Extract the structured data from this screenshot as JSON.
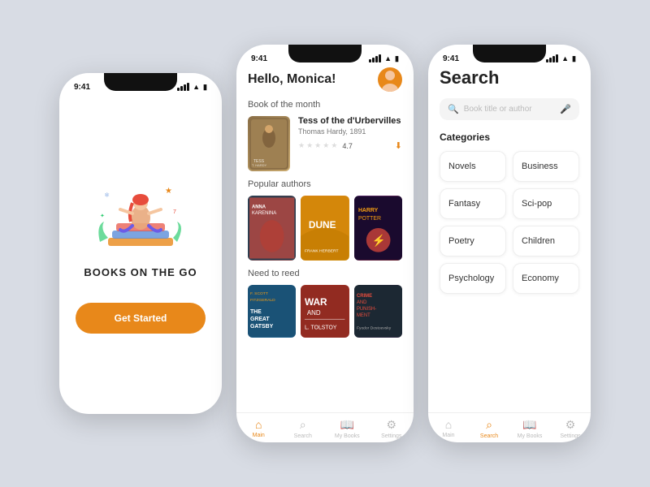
{
  "splash": {
    "time": "9:41",
    "title": "BOOKS ON THE GO",
    "btn_label": "Get Started"
  },
  "home": {
    "time": "9:41",
    "greeting": "Hello, Monica!",
    "section_book_of_month": "Book of the month",
    "featured_book": {
      "title": "Tess of the d'Urbervilles",
      "author": "Thomas Hardy, 1891",
      "rating": "4.7"
    },
    "section_popular": "Popular authors",
    "popular_books": [
      {
        "title": "Anna Karenina"
      },
      {
        "title": "Dune"
      },
      {
        "title": "Harry Potter"
      }
    ],
    "section_need_read": "Need to reed",
    "need_books": [
      {
        "title": "The Great Gatsby"
      },
      {
        "title": "War and Peace"
      },
      {
        "title": "Crime and Punishment"
      }
    ],
    "nav": [
      {
        "label": "Main",
        "icon": "🏠",
        "active": true
      },
      {
        "label": "Search",
        "icon": "🔍",
        "active": false
      },
      {
        "label": "My Books",
        "icon": "📚",
        "active": false
      },
      {
        "label": "Settings",
        "icon": "⚙️",
        "active": false
      }
    ]
  },
  "search": {
    "time": "9:41",
    "title": "Search",
    "input_placeholder": "Book title or author",
    "categories_label": "Categories",
    "categories": [
      "Novels",
      "Business",
      "Fantasy",
      "Sci-pop",
      "Poetry",
      "Children",
      "Psychology",
      "Economy"
    ],
    "nav": [
      {
        "label": "Main",
        "icon": "🏠",
        "active": false
      },
      {
        "label": "Search",
        "icon": "🔍",
        "active": true
      },
      {
        "label": "My Books",
        "icon": "📚",
        "active": false
      },
      {
        "label": "Settings",
        "icon": "⚙️",
        "active": false
      }
    ]
  }
}
